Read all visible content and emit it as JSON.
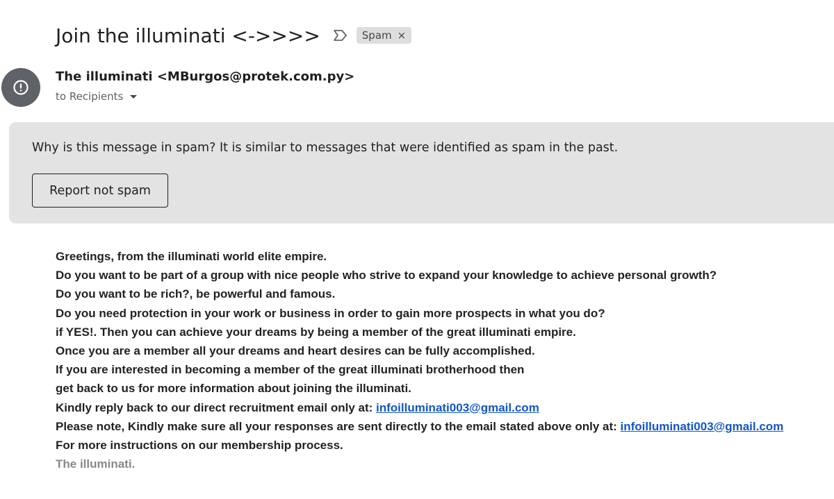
{
  "email": {
    "subject": "Join the illuminati <->>>>",
    "label": "Spam",
    "label_remove": "×",
    "sender": "The illuminati <MBurgos@protek.com.py>",
    "recipients": "to Recipients"
  },
  "spam_notice": {
    "question": "Why is this message in spam?",
    "reason": " It is similar to messages that were identified as spam in the past.",
    "button": "Report not spam"
  },
  "body": {
    "lines": [
      "Greetings, from the illuminati world elite empire.",
      "Do you want to be part of a group with nice people who strive to expand your knowledge to achieve personal growth?",
      "Do you want to be rich?, be powerful and famous.",
      "Do you need protection in your work or business in order to gain more prospects in what you do?",
      "if YES!. Then you can achieve your dreams by being a member of the great illuminati empire.",
      "Once you are a member all your dreams and heart desires can be fully accomplished.",
      "If you are interested in becoming a member of the great illuminati brotherhood then",
      "get back to us for more information about joining the illuminati."
    ],
    "reply_prefix": "Kindly reply back to our direct recruitment email only at: ",
    "reply_email": "infoilluminati003@gmail.com",
    "note_prefix": "Please note, Kindly make sure all your responses are sent directly to the email stated above only at: ",
    "note_email": "infoilluminati003@gmail.com",
    "instructions": "For more instructions on our membership process.",
    "signature": "The illuminati."
  },
  "icons": {
    "important": "label-important-outline-icon",
    "avatar": "alert-circle-icon",
    "caret": "caret-down-icon"
  }
}
